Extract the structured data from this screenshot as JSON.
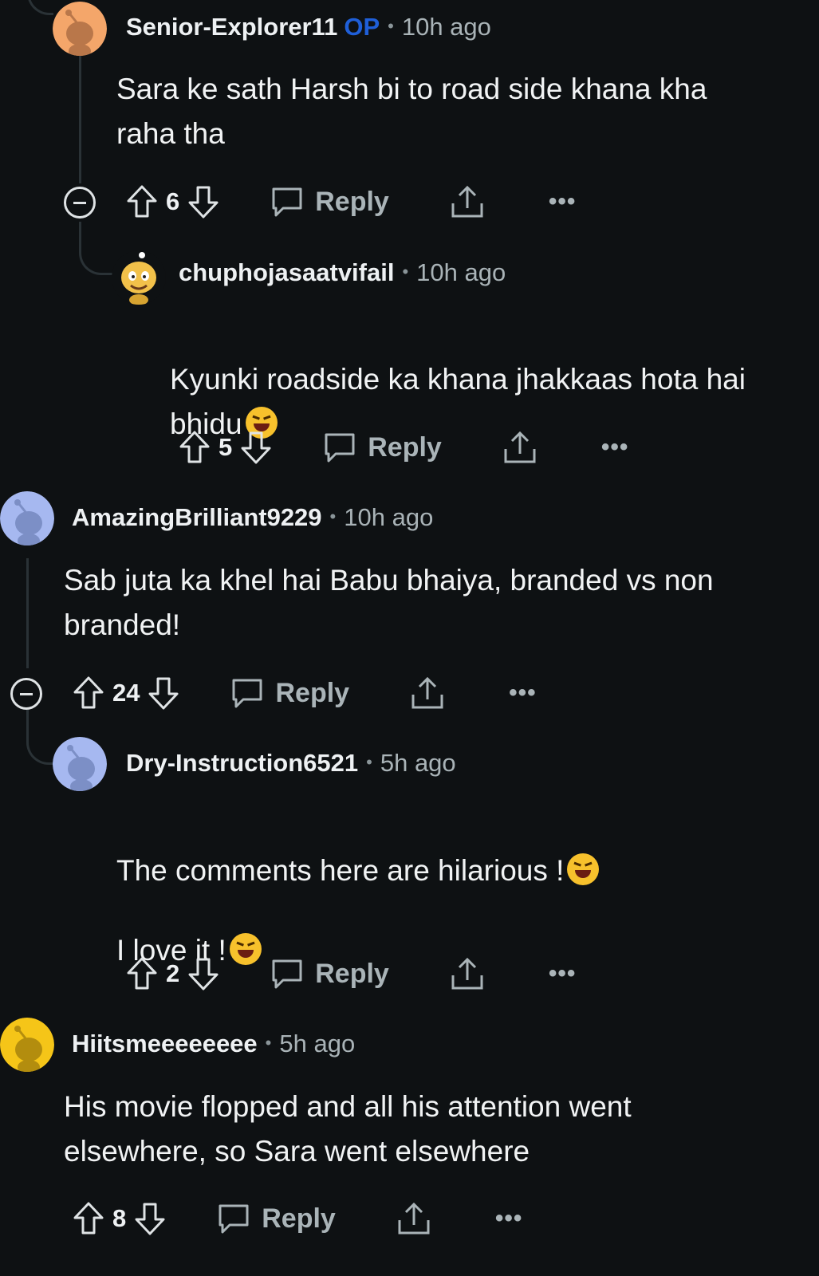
{
  "comments": [
    {
      "user": "Senior-Explorer11",
      "op_badge": "OP",
      "separator": "•",
      "time": "10h ago",
      "body": "Sara ke sath Harsh bi to road side khana kha\nraha tha",
      "score": "6",
      "reply_label": "Reply",
      "more_label": "•••",
      "avatar_color": "#f4a66a"
    },
    {
      "user": "chuphojasaatvifail",
      "separator": "•",
      "time": "10h ago",
      "body": "Kyunki roadside ka khana jhakkaas hota hai\nbhidu",
      "score": "5",
      "reply_label": "Reply",
      "more_label": "•••",
      "emoji": "rolling-on-floor-laughing-emoji"
    },
    {
      "user": "AmazingBrilliant9229",
      "separator": "•",
      "time": "10h ago",
      "body": "Sab juta ka khel hai Babu bhaiya, branded vs non\nbranded!",
      "score": "24",
      "reply_label": "Reply",
      "more_label": "•••",
      "avatar_color": "#a6b8f0"
    },
    {
      "user": "Dry-Instruction6521",
      "separator": "•",
      "time": "5h ago",
      "body_line1": "The comments here are hilarious !",
      "body_line2": "I love it !",
      "score": "2",
      "reply_label": "Reply",
      "more_label": "•••",
      "avatar_color": "#a6b8f0",
      "emoji": "grinning-squinting-face-emoji"
    },
    {
      "user": "Hiitsmeeeeeeee",
      "separator": "•",
      "time": "5h ago",
      "body": "His movie flopped and all his attention went\nelsewhere, so Sara went elsewhere",
      "score": "8",
      "reply_label": "Reply",
      "more_label": "•••",
      "avatar_color": "#f5c518"
    }
  ]
}
